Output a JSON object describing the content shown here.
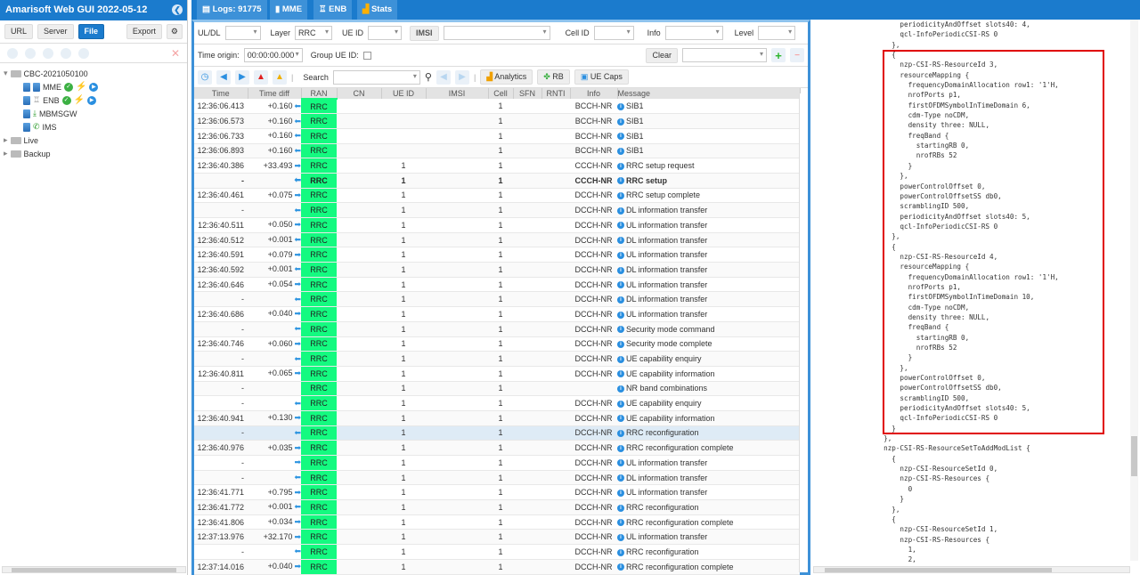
{
  "app": {
    "title": "Amarisoft Web GUI 2022-05-12"
  },
  "left": {
    "buttons": [
      "URL",
      "Server",
      "File",
      "Export"
    ],
    "tree": [
      {
        "label": "CBC-2021050100",
        "type": "folder",
        "expanded": true
      },
      {
        "label": "MME",
        "type": "node",
        "status": true
      },
      {
        "label": "ENB",
        "type": "node",
        "status": true
      },
      {
        "label": "MBMSGW",
        "type": "node",
        "status": false
      },
      {
        "label": "IMS",
        "type": "node",
        "status": false
      },
      {
        "label": "Live",
        "type": "folder",
        "expanded": false
      },
      {
        "label": "Backup",
        "type": "folder",
        "expanded": false
      }
    ]
  },
  "tabs": [
    {
      "label": "Logs: 91775",
      "icon": "document-icon"
    },
    {
      "label": "MME",
      "icon": "server-icon"
    },
    {
      "label": "ENB",
      "icon": "antenna-icon"
    },
    {
      "label": "Stats",
      "icon": "chart-icon"
    }
  ],
  "filters": {
    "uldl_label": "UL/DL",
    "uldl_value": "",
    "layer_label": "Layer",
    "layer_value": "RRC",
    "ueid_label": "UE ID",
    "ueid_value": "",
    "imsi_label": "IMSI",
    "imsi_value": "",
    "cellid_label": "Cell ID",
    "cellid_value": "",
    "info_label": "Info",
    "info_value": "",
    "level_label": "Level",
    "level_value": "",
    "time_origin_label": "Time origin:",
    "time_origin_value": "00:00:00.000",
    "group_ueid_label": "Group UE ID:",
    "clear_label": "Clear"
  },
  "toolbar": {
    "search_label": "Search",
    "search_value": "",
    "analytics": "Analytics",
    "rb": "RB",
    "uecaps": "UE Caps"
  },
  "columns": [
    "Time",
    "Time diff",
    "RAN",
    "CN",
    "UE ID",
    "IMSI",
    "Cell",
    "SFN",
    "RNTI",
    "Info",
    "Message"
  ],
  "rows": [
    {
      "time": "12:36:06.413",
      "diff": "+0.160",
      "dir": "dl",
      "ran": "RRC",
      "ueid": "",
      "cell": "1",
      "info": "BCCH-NR",
      "msg": "SIB1"
    },
    {
      "time": "12:36:06.573",
      "diff": "+0.160",
      "dir": "dl",
      "ran": "RRC",
      "ueid": "",
      "cell": "1",
      "info": "BCCH-NR",
      "msg": "SIB1"
    },
    {
      "time": "12:36:06.733",
      "diff": "+0.160",
      "dir": "dl",
      "ran": "RRC",
      "ueid": "",
      "cell": "1",
      "info": "BCCH-NR",
      "msg": "SIB1"
    },
    {
      "time": "12:36:06.893",
      "diff": "+0.160",
      "dir": "dl",
      "ran": "RRC",
      "ueid": "",
      "cell": "1",
      "info": "BCCH-NR",
      "msg": "SIB1"
    },
    {
      "time": "12:36:40.386",
      "diff": "+33.493",
      "dir": "ul",
      "ran": "RRC",
      "ueid": "1",
      "cell": "1",
      "info": "CCCH-NR",
      "msg": "RRC setup request"
    },
    {
      "time": "-",
      "diff": "",
      "dir": "dl",
      "ran": "RRC",
      "ueid": "1",
      "cell": "1",
      "info": "CCCH-NR",
      "msg": "RRC setup",
      "selected": true
    },
    {
      "time": "12:36:40.461",
      "diff": "+0.075",
      "dir": "ul",
      "ran": "RRC",
      "ueid": "1",
      "cell": "1",
      "info": "DCCH-NR",
      "msg": "RRC setup complete"
    },
    {
      "time": "-",
      "diff": "",
      "dir": "dl",
      "ran": "RRC",
      "ueid": "1",
      "cell": "1",
      "info": "DCCH-NR",
      "msg": "DL information transfer"
    },
    {
      "time": "12:36:40.511",
      "diff": "+0.050",
      "dir": "ul",
      "ran": "RRC",
      "ueid": "1",
      "cell": "1",
      "info": "DCCH-NR",
      "msg": "UL information transfer"
    },
    {
      "time": "12:36:40.512",
      "diff": "+0.001",
      "dir": "dl",
      "ran": "RRC",
      "ueid": "1",
      "cell": "1",
      "info": "DCCH-NR",
      "msg": "DL information transfer"
    },
    {
      "time": "12:36:40.591",
      "diff": "+0.079",
      "dir": "ul",
      "ran": "RRC",
      "ueid": "1",
      "cell": "1",
      "info": "DCCH-NR",
      "msg": "UL information transfer"
    },
    {
      "time": "12:36:40.592",
      "diff": "+0.001",
      "dir": "dl",
      "ran": "RRC",
      "ueid": "1",
      "cell": "1",
      "info": "DCCH-NR",
      "msg": "DL information transfer"
    },
    {
      "time": "12:36:40.646",
      "diff": "+0.054",
      "dir": "ul",
      "ran": "RRC",
      "ueid": "1",
      "cell": "1",
      "info": "DCCH-NR",
      "msg": "UL information transfer"
    },
    {
      "time": "-",
      "diff": "",
      "dir": "dl",
      "ran": "RRC",
      "ueid": "1",
      "cell": "1",
      "info": "DCCH-NR",
      "msg": "DL information transfer"
    },
    {
      "time": "12:36:40.686",
      "diff": "+0.040",
      "dir": "ul",
      "ran": "RRC",
      "ueid": "1",
      "cell": "1",
      "info": "DCCH-NR",
      "msg": "UL information transfer"
    },
    {
      "time": "-",
      "diff": "",
      "dir": "dl",
      "ran": "RRC",
      "ueid": "1",
      "cell": "1",
      "info": "DCCH-NR",
      "msg": "Security mode command"
    },
    {
      "time": "12:36:40.746",
      "diff": "+0.060",
      "dir": "ul",
      "ran": "RRC",
      "ueid": "1",
      "cell": "1",
      "info": "DCCH-NR",
      "msg": "Security mode complete"
    },
    {
      "time": "-",
      "diff": "",
      "dir": "dl",
      "ran": "RRC",
      "ueid": "1",
      "cell": "1",
      "info": "DCCH-NR",
      "msg": "UE capability enquiry"
    },
    {
      "time": "12:36:40.811",
      "diff": "+0.065",
      "dir": "ul",
      "ran": "RRC",
      "ueid": "1",
      "cell": "1",
      "info": "DCCH-NR",
      "msg": "UE capability information"
    },
    {
      "time": "-",
      "diff": "",
      "dir": "",
      "ran": "RRC",
      "ueid": "1",
      "cell": "1",
      "info": "",
      "msg": "NR band combinations"
    },
    {
      "time": "-",
      "diff": "",
      "dir": "dl",
      "ran": "RRC",
      "ueid": "1",
      "cell": "1",
      "info": "DCCH-NR",
      "msg": "UE capability enquiry"
    },
    {
      "time": "12:36:40.941",
      "diff": "+0.130",
      "dir": "ul",
      "ran": "RRC",
      "ueid": "1",
      "cell": "1",
      "info": "DCCH-NR",
      "msg": "UE capability information"
    },
    {
      "time": "-",
      "diff": "",
      "dir": "dl",
      "ran": "RRC",
      "ueid": "1",
      "cell": "1",
      "info": "DCCH-NR",
      "msg": "RRC reconfiguration",
      "hover": true
    },
    {
      "time": "12:36:40.976",
      "diff": "+0.035",
      "dir": "ul",
      "ran": "RRC",
      "ueid": "1",
      "cell": "1",
      "info": "DCCH-NR",
      "msg": "RRC reconfiguration complete"
    },
    {
      "time": "-",
      "diff": "",
      "dir": "ul",
      "ran": "RRC",
      "ueid": "1",
      "cell": "1",
      "info": "DCCH-NR",
      "msg": "UL information transfer"
    },
    {
      "time": "-",
      "diff": "",
      "dir": "dl",
      "ran": "RRC",
      "ueid": "1",
      "cell": "1",
      "info": "DCCH-NR",
      "msg": "DL information transfer"
    },
    {
      "time": "12:36:41.771",
      "diff": "+0.795",
      "dir": "ul",
      "ran": "RRC",
      "ueid": "1",
      "cell": "1",
      "info": "DCCH-NR",
      "msg": "UL information transfer"
    },
    {
      "time": "12:36:41.772",
      "diff": "+0.001",
      "dir": "dl",
      "ran": "RRC",
      "ueid": "1",
      "cell": "1",
      "info": "DCCH-NR",
      "msg": "RRC reconfiguration"
    },
    {
      "time": "12:36:41.806",
      "diff": "+0.034",
      "dir": "ul",
      "ran": "RRC",
      "ueid": "1",
      "cell": "1",
      "info": "DCCH-NR",
      "msg": "RRC reconfiguration complete"
    },
    {
      "time": "12:37:13.976",
      "diff": "+32.170",
      "dir": "ul",
      "ran": "RRC",
      "ueid": "1",
      "cell": "1",
      "info": "DCCH-NR",
      "msg": "UL information transfer"
    },
    {
      "time": "-",
      "diff": "",
      "dir": "dl",
      "ran": "RRC",
      "ueid": "1",
      "cell": "1",
      "info": "DCCH-NR",
      "msg": "RRC reconfiguration"
    },
    {
      "time": "12:37:14.016",
      "diff": "+0.040",
      "dir": "ul",
      "ran": "RRC",
      "ueid": "1",
      "cell": "1",
      "info": "DCCH-NR",
      "msg": "RRC reconfiguration complete"
    }
  ],
  "detail": {
    "text": "      periodicityAndOffset slots40: 4,\n      qcl-InfoPeriodicCSI-RS 0\n    },\n    {\n      nzp-CSI-RS-ResourceId 3,\n      resourceMapping {\n        frequencyDomainAllocation row1: '1'H,\n        nrofPorts p1,\n        firstOFDMSymbolInTimeDomain 6,\n        cdm-Type noCDM,\n        density three: NULL,\n        freqBand {\n          startingRB 0,\n          nrofRBs 52\n        }\n      },\n      powerControlOffset 0,\n      powerControlOffsetSS db0,\n      scramblingID 500,\n      periodicityAndOffset slots40: 5,\n      qcl-InfoPeriodicCSI-RS 0\n    },\n    {\n      nzp-CSI-RS-ResourceId 4,\n      resourceMapping {\n        frequencyDomainAllocation row1: '1'H,\n        nrofPorts p1,\n        firstOFDMSymbolInTimeDomain 10,\n        cdm-Type noCDM,\n        density three: NULL,\n        freqBand {\n          startingRB 0,\n          nrofRBs 52\n        }\n      },\n      powerControlOffset 0,\n      powerControlOffsetSS db0,\n      scramblingID 500,\n      periodicityAndOffset slots40: 5,\n      qcl-InfoPeriodicCSI-RS 0\n    }\n  },\n  nzp-CSI-RS-ResourceSetToAddModList {\n    {\n      nzp-CSI-ResourceSetId 0,\n      nzp-CSI-RS-Resources {\n        0\n      }\n    },\n    {\n      nzp-CSI-ResourceSetId 1,\n      nzp-CSI-RS-Resources {\n        1,\n        2,"
  },
  "colors": {
    "brand": "#1b7bcd",
    "ran_green": "#14fa80",
    "selected": "#bcbcf8",
    "highlight_box": "#e00000"
  }
}
